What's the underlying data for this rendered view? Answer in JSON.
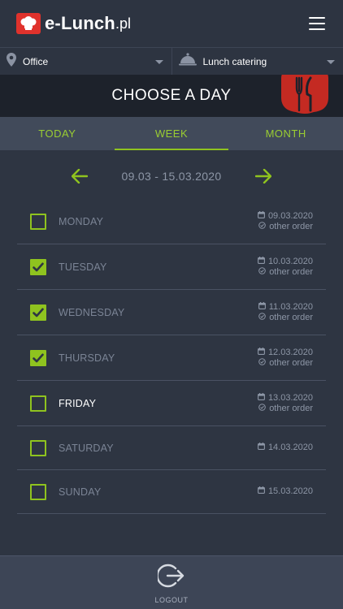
{
  "header": {
    "brand_name": "e-Lunch",
    "brand_tld": ".pl"
  },
  "selectors": {
    "location": "Office",
    "catering": "Lunch catering"
  },
  "banner": {
    "title": "CHOOSE A DAY"
  },
  "tabs": [
    {
      "label": "TODAY",
      "active": false
    },
    {
      "label": "WEEK",
      "active": true
    },
    {
      "label": "MONTH",
      "active": false
    }
  ],
  "week": {
    "range": "09.03 - 15.03.2020"
  },
  "days": [
    {
      "name": "MONDAY",
      "date": "09.03.2020",
      "note": "other order",
      "checked": false
    },
    {
      "name": "TUESDAY",
      "date": "10.03.2020",
      "note": "other order",
      "checked": true
    },
    {
      "name": "WEDNESDAY",
      "date": "11.03.2020",
      "note": "other order",
      "checked": true
    },
    {
      "name": "THURSDAY",
      "date": "12.03.2020",
      "note": "other order",
      "checked": true
    },
    {
      "name": "FRIDAY",
      "date": "13.03.2020",
      "note": "other order",
      "checked": false
    },
    {
      "name": "SATURDAY",
      "date": "14.03.2020",
      "checked": false
    },
    {
      "name": "SUNDAY",
      "date": "15.03.2020",
      "checked": false
    }
  ],
  "footer": {
    "logout_label": "LOGOUT"
  },
  "colors": {
    "accent_green": "#8fc31f",
    "brand_red": "#e0322c",
    "background": "#2e3542"
  }
}
